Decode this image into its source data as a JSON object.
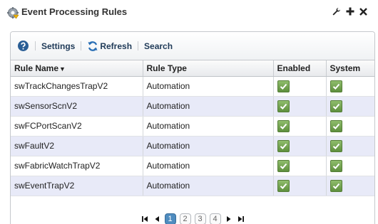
{
  "window": {
    "title": "Event Processing Rules",
    "controls": [
      "wrench-icon",
      "plus-icon",
      "close-icon"
    ]
  },
  "toolbar": {
    "help_icon": "help-icon",
    "settings_label": "Settings",
    "refresh_label": "Refresh",
    "search_label": "Search"
  },
  "table": {
    "columns": [
      "Rule Name",
      "Rule Type",
      "Enabled",
      "System"
    ],
    "sorted_column": "Rule Name",
    "rows": [
      {
        "name": "swTrackChangesTrapV2",
        "type": "Automation",
        "enabled": true,
        "system": true
      },
      {
        "name": "swSensorScnV2",
        "type": "Automation",
        "enabled": true,
        "system": true
      },
      {
        "name": "swFCPortScanV2",
        "type": "Automation",
        "enabled": true,
        "system": true
      },
      {
        "name": "swFaultV2",
        "type": "Automation",
        "enabled": true,
        "system": true
      },
      {
        "name": "swFabricWatchTrapV2",
        "type": "Automation",
        "enabled": true,
        "system": true
      },
      {
        "name": "swEventTrapV2",
        "type": "Automation",
        "enabled": true,
        "system": true
      }
    ]
  },
  "pager": {
    "pages": [
      "1",
      "2",
      "3",
      "4"
    ],
    "current_page": "1"
  },
  "colors": {
    "checkbox_green": "#6a9b47",
    "row_alt": "#e8eaf8",
    "active_page": "#4f8cbf",
    "toolbar_text": "#1f3a58"
  }
}
